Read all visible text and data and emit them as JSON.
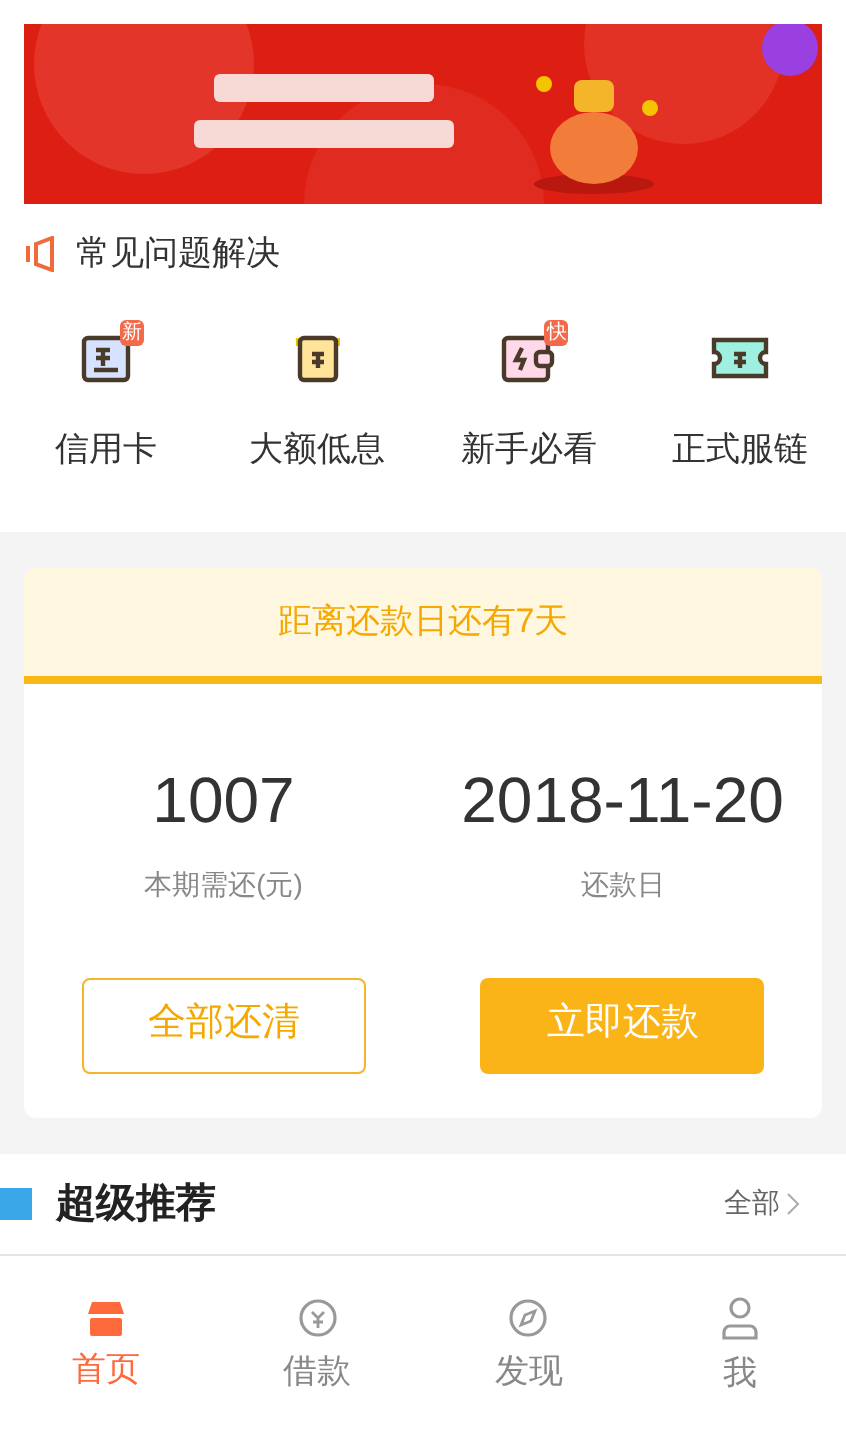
{
  "faq": {
    "title": "常见问题解决",
    "items": [
      {
        "label": "信用卡",
        "badge": "新",
        "kind": "card"
      },
      {
        "label": "大额低息",
        "kind": "scroll"
      },
      {
        "label": "新手必看",
        "badge": "快",
        "kind": "wallet"
      },
      {
        "label": "正式服链",
        "kind": "ticket"
      }
    ]
  },
  "repayment": {
    "notice": "距离还款日还有7天",
    "amount": "1007",
    "amount_label": "本期需还(元)",
    "date": "2018-11-20",
    "date_label": "还款日",
    "buttons": [
      {
        "label": "全部还清",
        "kind": "outline"
      },
      {
        "label": "立即还款",
        "kind": "solid"
      }
    ]
  },
  "recommend": {
    "title": "超级推荐",
    "more": "全部"
  },
  "tabs": [
    {
      "label": "首页",
      "selected": true,
      "kind": "home"
    },
    {
      "label": "借款",
      "selected": false,
      "kind": "loan"
    },
    {
      "label": "发现",
      "selected": false,
      "kind": "discover"
    },
    {
      "label": "我",
      "selected": false,
      "kind": "me"
    }
  ]
}
